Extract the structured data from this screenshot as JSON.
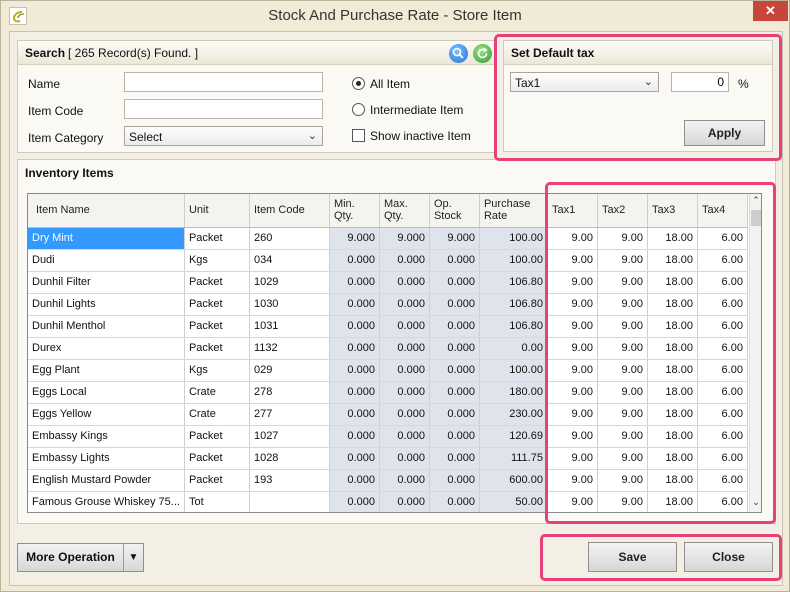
{
  "window": {
    "title": "Stock And Purchase Rate - Store Item",
    "close_glyph": "✕"
  },
  "search": {
    "title": "Search",
    "count_text": "[ 265 Record(s) Found. ]",
    "name_label": "Name",
    "name_value": "",
    "code_label": "Item Code",
    "code_value": "",
    "category_label": "Item Category",
    "category_value": "Select",
    "radio_all": "All Item",
    "radio_intermediate": "Intermediate Item",
    "checkbox_inactive": "Show inactive Item",
    "selected_radio": "All Item",
    "show_inactive_checked": false
  },
  "tax": {
    "title": "Set Default tax",
    "tax_select": "Tax1",
    "percent_value": "0",
    "percent_unit": "%",
    "apply_label": "Apply"
  },
  "inventory": {
    "title": "Inventory Items",
    "columns": [
      "Item Name",
      "Unit",
      "Item Code",
      "Min. Qty.",
      "Max. Qty.",
      "Op. Stock",
      "Purchase Rate",
      "Tax1",
      "Tax2",
      "Tax3",
      "Tax4"
    ],
    "rows": [
      [
        "Dry Mint",
        "Packet",
        "260",
        "9.000",
        "9.000",
        "9.000",
        "100.00",
        "9.00",
        "9.00",
        "18.00",
        "6.00"
      ],
      [
        "Dudi",
        "Kgs",
        "034",
        "0.000",
        "0.000",
        "0.000",
        "100.00",
        "9.00",
        "9.00",
        "18.00",
        "6.00"
      ],
      [
        "Dunhil Filter",
        "Packet",
        "1029",
        "0.000",
        "0.000",
        "0.000",
        "106.80",
        "9.00",
        "9.00",
        "18.00",
        "6.00"
      ],
      [
        "Dunhil Lights",
        "Packet",
        "1030",
        "0.000",
        "0.000",
        "0.000",
        "106.80",
        "9.00",
        "9.00",
        "18.00",
        "6.00"
      ],
      [
        "Dunhil Menthol",
        "Packet",
        "1031",
        "0.000",
        "0.000",
        "0.000",
        "106.80",
        "9.00",
        "9.00",
        "18.00",
        "6.00"
      ],
      [
        "Durex",
        "Packet",
        "1132",
        "0.000",
        "0.000",
        "0.000",
        "0.00",
        "9.00",
        "9.00",
        "18.00",
        "6.00"
      ],
      [
        "Egg Plant",
        "Kgs",
        "029",
        "0.000",
        "0.000",
        "0.000",
        "100.00",
        "9.00",
        "9.00",
        "18.00",
        "6.00"
      ],
      [
        "Eggs Local",
        "Crate",
        "278",
        "0.000",
        "0.000",
        "0.000",
        "180.00",
        "9.00",
        "9.00",
        "18.00",
        "6.00"
      ],
      [
        "Eggs Yellow",
        "Crate",
        "277",
        "0.000",
        "0.000",
        "0.000",
        "230.00",
        "9.00",
        "9.00",
        "18.00",
        "6.00"
      ],
      [
        "Embassy Kings",
        "Packet",
        "1027",
        "0.000",
        "0.000",
        "0.000",
        "120.69",
        "9.00",
        "9.00",
        "18.00",
        "6.00"
      ],
      [
        "Embassy Lights",
        "Packet",
        "1028",
        "0.000",
        "0.000",
        "0.000",
        "111.75",
        "9.00",
        "9.00",
        "18.00",
        "6.00"
      ],
      [
        "English Mustard Powder",
        "Packet",
        "193",
        "0.000",
        "0.000",
        "0.000",
        "600.00",
        "9.00",
        "9.00",
        "18.00",
        "6.00"
      ],
      [
        "Famous Grouse Whiskey 75...",
        "Tot",
        "",
        "0.000",
        "0.000",
        "0.000",
        "50.00",
        "9.00",
        "9.00",
        "18.00",
        "6.00"
      ]
    ]
  },
  "footer": {
    "more_operation_label": "More Operation",
    "save_label": "Save",
    "close_label": "Close"
  },
  "colors": {
    "highlight": "#e8407a",
    "selection": "#3399ff",
    "shaded_column": "#dfe3ec"
  }
}
